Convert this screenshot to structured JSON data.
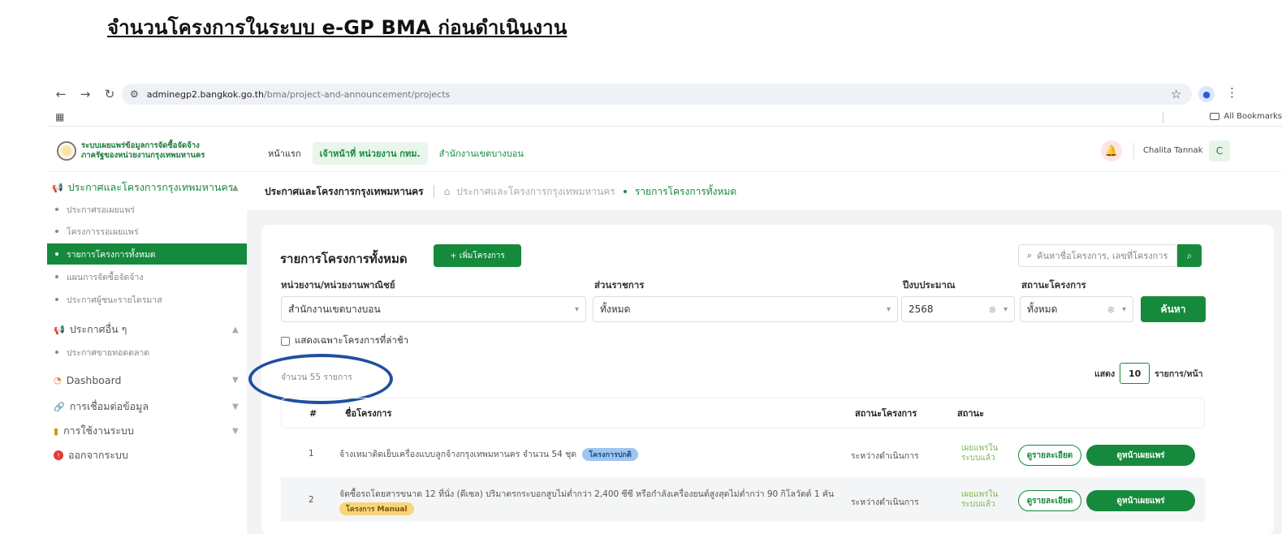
{
  "caption": "จำนวนโครงการในระบบ e-GP BMA ก่อนดำเนินงาน",
  "browser": {
    "url_host": "adminegp2.bangkok.go.th",
    "url_path": "/bma/project-and-announcement/projects",
    "bookmarks_label": "All Bookmarks"
  },
  "app": {
    "logo_line1": "ระบบเผยแพร่ข้อมูลการจัดซื้อจัดจ้าง",
    "logo_line2": "ภาครัฐของหน่วยงานกรุงเทพมหานคร",
    "nav_home": "หน้าแรก",
    "nav_role": "เจ้าหน้าที่ หน่วยงาน กทม.",
    "nav_office": "สำนักงานเขตบางบอน",
    "user_name": "Chalita Tannak",
    "user_initial": "C"
  },
  "sidebar": {
    "section1": "ประกาศและโครงการกรุงเทพมหานคร",
    "items1": [
      "ประกาศรอเผยแพร่",
      "โครงการรอเผยแพร่",
      "รายการโครงการทั้งหมด",
      "แผนการจัดซื้อจัดจ้าง",
      "ประกาศผู้ชนะรายไตรมาส"
    ],
    "section2": "ประกาศอื่น ๆ",
    "items2": [
      "ประกาศขายทอดตลาด"
    ],
    "dashboard": "Dashboard",
    "connect": "การเชื่อมต่อข้อมูล",
    "usage": "การใช้งานระบบ",
    "logout": "ออกจากระบบ"
  },
  "breadcrumb": {
    "title": "ประกาศและโครงการกรุงเทพมหานคร",
    "mid": "ประกาศและโครงการกรุงเทพมหานคร",
    "current": "รายการโครงการทั้งหมด"
  },
  "content": {
    "title": "รายการโครงการทั้งหมด",
    "add_button": "+ เพิ่มโครงการ",
    "search_placeholder": "ค้นหาชื่อโครงการ, เลขที่โครงการ",
    "filters": {
      "agency_label": "หน่วยงาน/หน่วยงานพาณิชย์",
      "agency_value": "สำนักงานเขตบางบอน",
      "division_label": "ส่วนราชการ",
      "division_value": "ทั้งหมด",
      "year_label": "ปีงบประมาณ",
      "year_value": "2568",
      "status_label": "สถานะโครงการ",
      "status_value": "ทั้งหมด",
      "find_button": "ค้นหา"
    },
    "checkbox_label": "แสดงเฉพาะโครงการที่ล่าช้า",
    "count_text": "จำนวน 55 รายการ",
    "show_label": "แสดง",
    "per_page": "10",
    "per_page_suffix": "รายการ/หน้า",
    "table": {
      "headers": [
        "#",
        "ชื่อโครงการ",
        "สถานะโครงการ",
        "สถานะ"
      ],
      "rows": [
        {
          "no": "1",
          "name": "จ้างเหมาติดเย็บเครื่องแบบลูกจ้างกรุงเทพมหานคร จำนวน 54 ชุด",
          "tag": "โครงการปกติ",
          "project_status": "ระหว่างดำเนินการ",
          "pub_line1": "เผยแพร่ใน",
          "pub_line2": "ระบบแล้ว",
          "detail_btn": "ดูรายละเอียด",
          "pub_btn": "ดูหน้าเผยแพร่"
        },
        {
          "no": "2",
          "name": "จัดซื้อรถโดยสารขนาด 12 ที่นั่ง (ดีเซล) ปริมาตรกระบอกสูบไม่ต่ำกว่า 2,400 ซีซี หรือกำลังเครื่องยนต์สูงสุดไม่ต่ำกว่า 90 กิโลวัตต์ 1 คัน",
          "tag": "โครงการ Manual",
          "project_status": "ระหว่างดำเนินการ",
          "pub_line1": "เผยแพร่ใน",
          "pub_line2": "ระบบแล้ว",
          "detail_btn": "ดูรายละเอียด",
          "pub_btn": "ดูหน้าเผยแพร่"
        }
      ]
    }
  }
}
